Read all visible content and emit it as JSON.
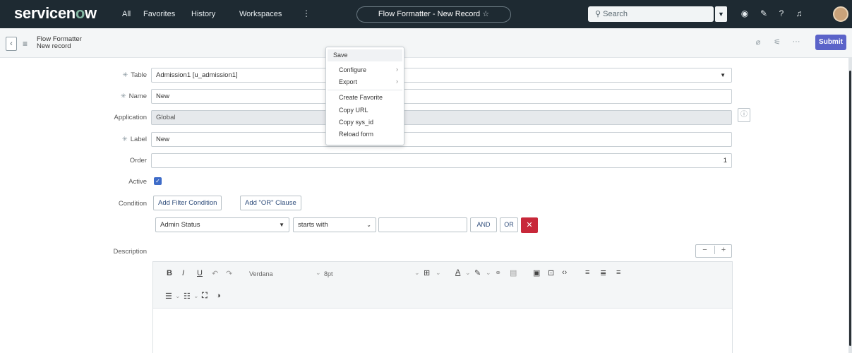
{
  "topnav": {
    "brand_prefix": "servicen",
    "brand_o": "o",
    "brand_suffix": "w",
    "links": [
      "All",
      "Favorites",
      "History",
      "Workspaces"
    ],
    "more": "⋮",
    "record_title": "Flow Formatter - New Record",
    "search_placeholder": "Search"
  },
  "header": {
    "title_line1": "Flow Formatter",
    "title_line2": "New record",
    "submit_label": "Submit"
  },
  "fields": {
    "table": {
      "label": "Table",
      "value": "Admission1 [u_admission1]"
    },
    "name": {
      "label": "Name",
      "value": "New"
    },
    "application": {
      "label": "Application",
      "value": "Global"
    },
    "label": {
      "label": "Label",
      "value": "New"
    },
    "order": {
      "label": "Order",
      "value": "1"
    },
    "active": {
      "label": "Active",
      "checked": true
    },
    "condition": {
      "label": "Condition",
      "add_filter_label": "Add Filter Condition",
      "add_or_label": "Add \"OR\" Clause",
      "field_value": "Admin Status",
      "operator_value": "starts with",
      "and_label": "AND",
      "or_label": "OR"
    },
    "description": {
      "label": "Description"
    }
  },
  "editor": {
    "font_family": "Verdana",
    "font_size": "8pt"
  },
  "context_menu": {
    "items": [
      "Save",
      "Configure",
      "Export",
      "Create Favorite",
      "Copy URL",
      "Copy sys_id",
      "Reload form"
    ]
  },
  "colors": {
    "nav_bg": "#1e2a32",
    "submit_bg": "#5b63c9",
    "delete_bg": "#c8283a",
    "checkbox": "#3f6cc8"
  }
}
